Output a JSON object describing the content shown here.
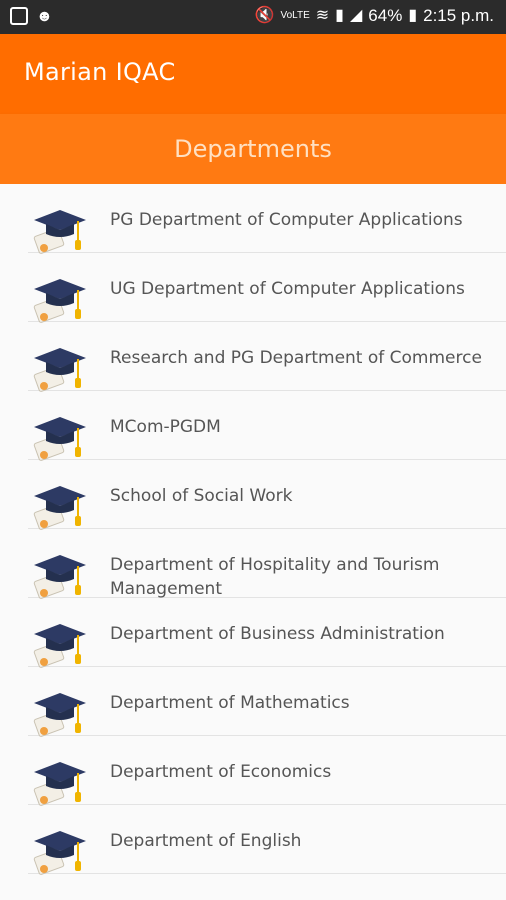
{
  "status_bar": {
    "battery_percent": "64%",
    "time": "2:15 p.m.",
    "icons": [
      "gallery-icon",
      "wechat-icon",
      "mute-icon",
      "volte-icon",
      "wifi-icon",
      "sim-icon",
      "signal-icon",
      "battery-icon"
    ]
  },
  "app_bar": {
    "title": "Marian IQAC"
  },
  "section": {
    "title": "Departments"
  },
  "departments": [
    {
      "label": "PG Department of Computer Applications"
    },
    {
      "label": "UG Department of Computer Applications"
    },
    {
      "label": "Research and PG Department of Commerce"
    },
    {
      "label": "MCom-PGDM"
    },
    {
      "label": "School of Social Work"
    },
    {
      "label": "Department of Hospitality and Tourism Management"
    },
    {
      "label": "Department of Business Administration"
    },
    {
      "label": "Department of Mathematics"
    },
    {
      "label": "Department of Economics"
    },
    {
      "label": "Department of English"
    }
  ],
  "colors": {
    "app_bar": "#ff6d00",
    "section_header": "#ff7a12",
    "status_bar": "#2b2b2b",
    "cap": "#2d3a64",
    "tassel": "#f0b400"
  }
}
